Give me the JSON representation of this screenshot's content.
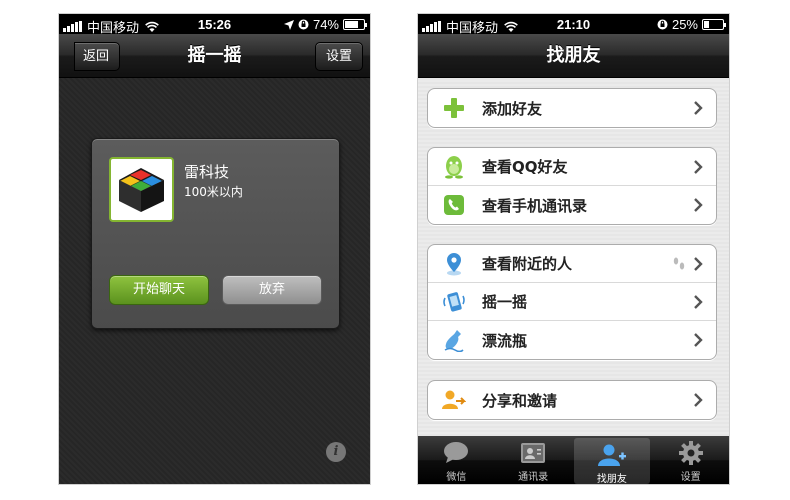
{
  "left_screen": {
    "status": {
      "carrier": "中国移动",
      "time": "15:26",
      "battery": "74%",
      "battery_level": 0.74
    },
    "navbar": {
      "title": "摇一摇",
      "back_label": "返回",
      "settings_label": "设置"
    },
    "result_card": {
      "name": "雷科技",
      "distance": "100米以内",
      "chat_label": "开始聊天",
      "giveup_label": "放弃"
    },
    "info_icon": "i"
  },
  "right_screen": {
    "status": {
      "carrier": "中国移动",
      "time": "21:10",
      "battery": "25%",
      "battery_level": 0.25
    },
    "navbar": {
      "title": "找朋友"
    },
    "groups": [
      {
        "items": [
          {
            "icon": "plus-icon",
            "label": "添加好友"
          }
        ]
      },
      {
        "items": [
          {
            "icon": "qq-penguin-icon",
            "label": "查看QQ好友"
          },
          {
            "icon": "phone-book-icon",
            "label": "查看手机通讯录"
          }
        ]
      },
      {
        "items": [
          {
            "icon": "location-pin-icon",
            "label": "查看附近的人"
          },
          {
            "icon": "shake-phone-icon",
            "label": "摇一摇"
          },
          {
            "icon": "bottle-icon",
            "label": "漂流瓶"
          }
        ]
      },
      {
        "items": [
          {
            "icon": "share-invite-icon",
            "label": "分享和邀请"
          }
        ]
      }
    ],
    "tabs": [
      {
        "icon": "chat-bubble-icon",
        "label": "微信",
        "active": false
      },
      {
        "icon": "contacts-card-icon",
        "label": "通讯录",
        "active": false
      },
      {
        "icon": "add-friend-icon",
        "label": "找朋友",
        "active": true
      },
      {
        "icon": "gear-icon",
        "label": "设置",
        "active": false
      }
    ]
  },
  "colors": {
    "accent_green": "#6aa52a",
    "nav_dark": "#1b1b1b",
    "list_bg": "#e8e8e8",
    "active_tab_blue": "#4aa3ee"
  }
}
